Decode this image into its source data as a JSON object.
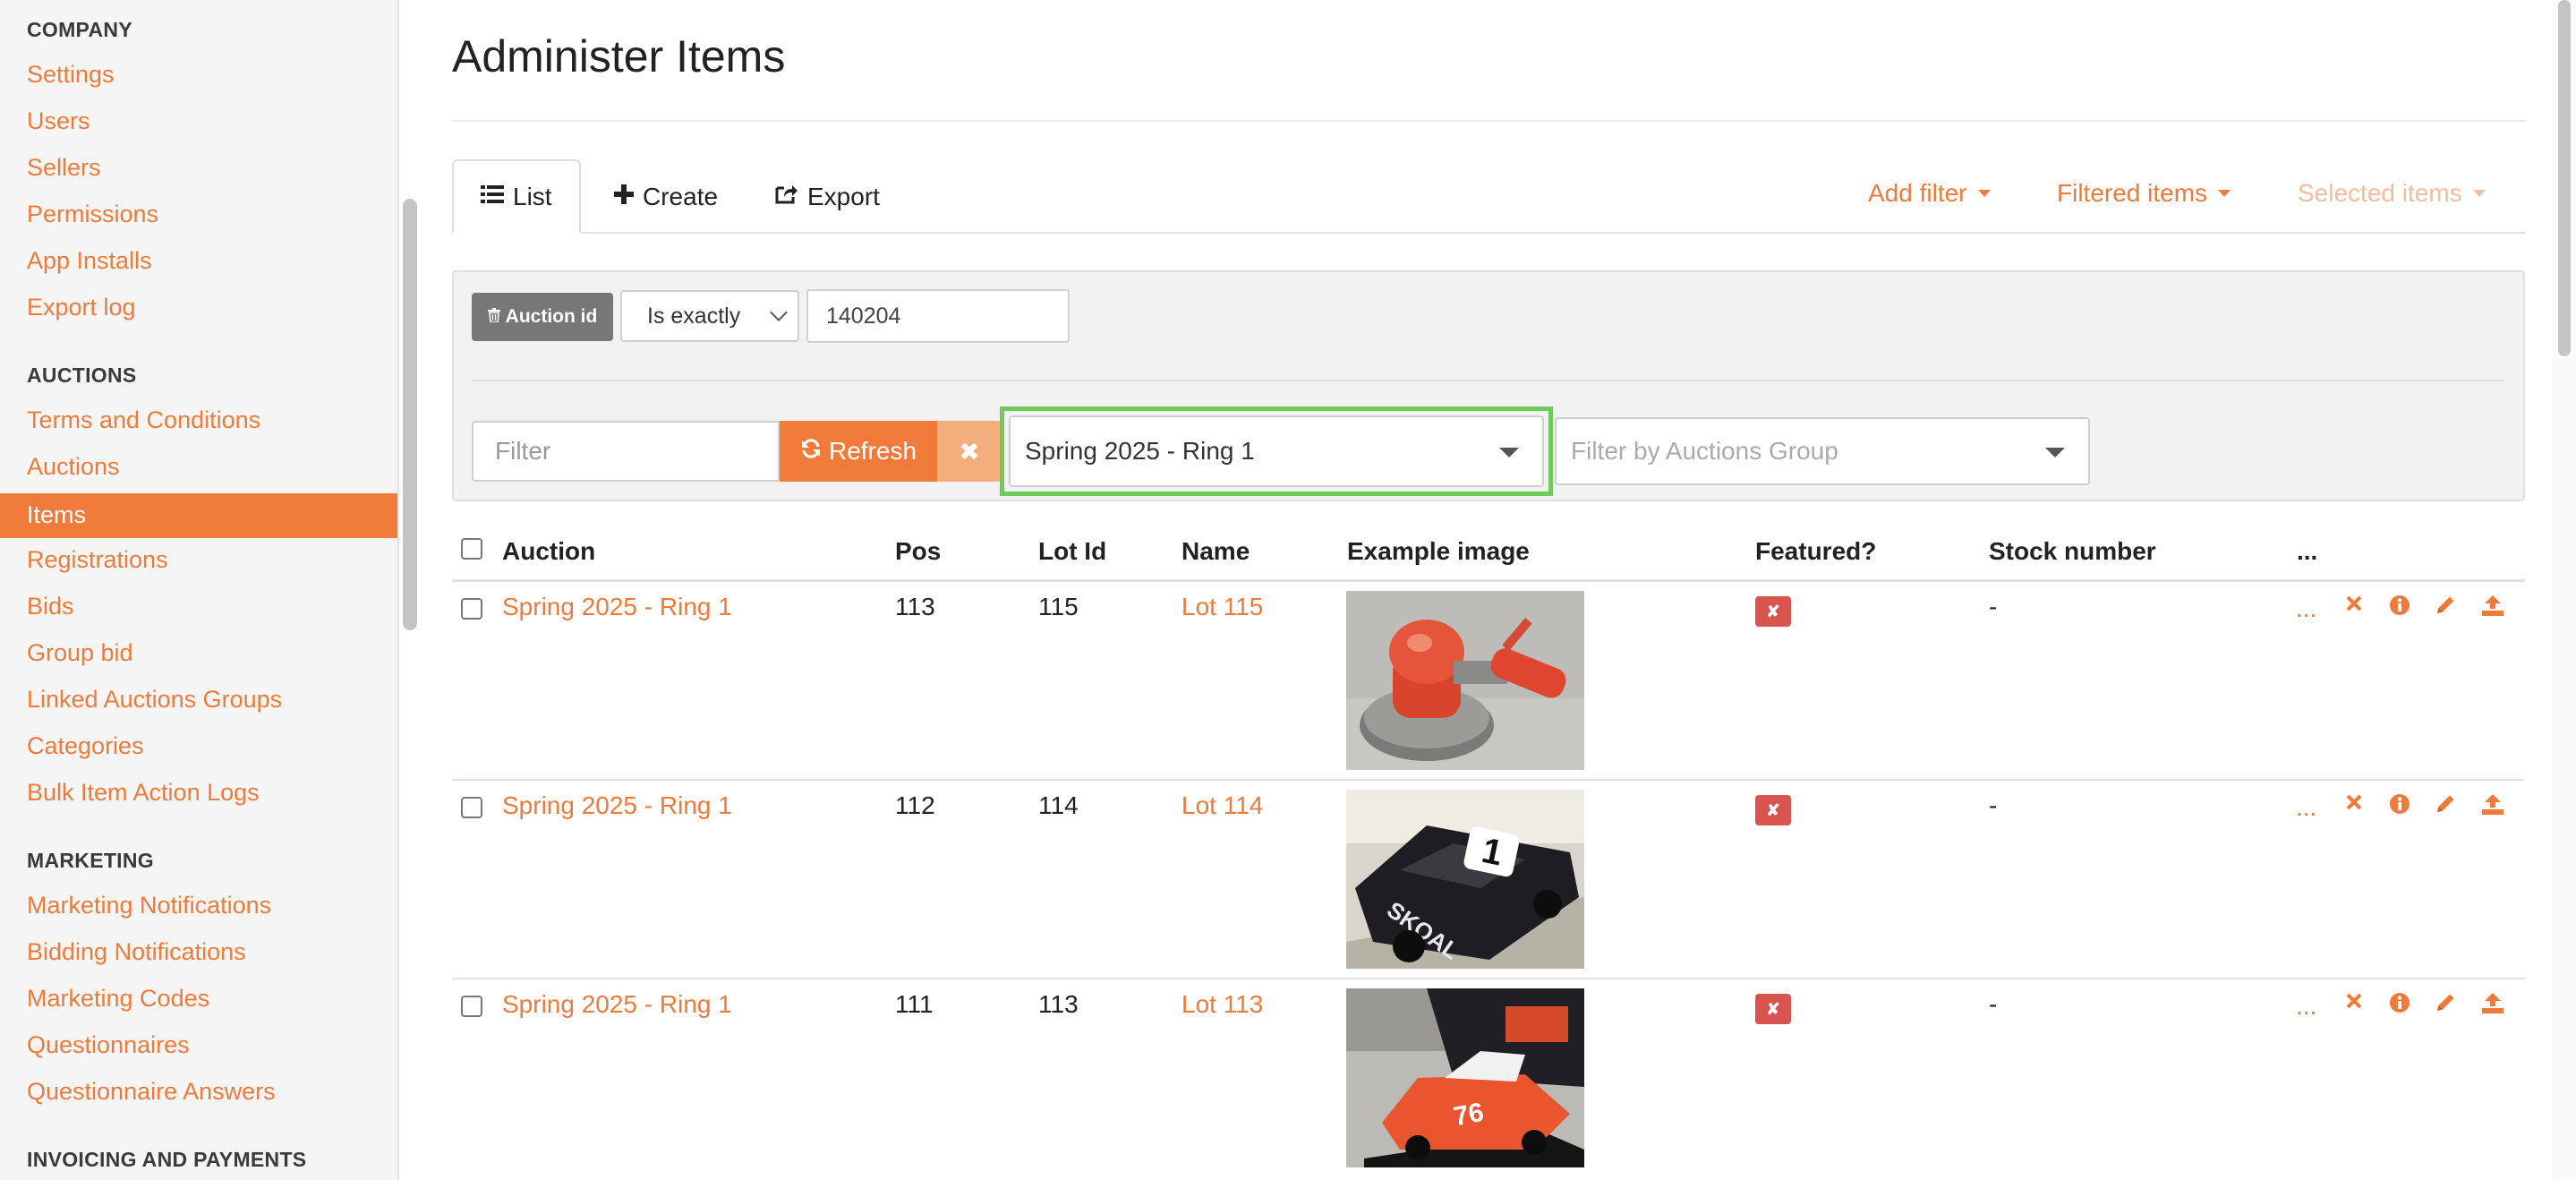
{
  "sidebar": {
    "company_heading": "COMPANY",
    "company_items": [
      "Settings",
      "Users",
      "Sellers",
      "Permissions",
      "App Installs",
      "Export log"
    ],
    "auctions_heading": "AUCTIONS",
    "auctions_items": [
      "Terms and Conditions",
      "Auctions",
      "Items",
      "Registrations",
      "Bids",
      "Group bid",
      "Linked Auctions Groups",
      "Categories",
      "Bulk Item Action Logs"
    ],
    "active_item": "Items",
    "marketing_heading": "MARKETING",
    "marketing_items": [
      "Marketing Notifications",
      "Bidding Notifications",
      "Marketing Codes",
      "Questionnaires",
      "Questionnaire Answers"
    ],
    "invoicing_heading": "INVOICING AND PAYMENTS"
  },
  "page": {
    "title": "Administer Items"
  },
  "tabs": {
    "list": "List",
    "create": "Create",
    "export": "Export",
    "add_filter": "Add filter",
    "filtered_items": "Filtered items",
    "selected_items": "Selected items"
  },
  "filters": {
    "chip_label": "Auction id",
    "operator": "Is exactly",
    "value": "140204",
    "search_placeholder": "Filter",
    "refresh_label": "Refresh",
    "clear_label": "✖",
    "auction_selected": "Spring 2025 - Ring 1",
    "group_placeholder": "Filter by Auctions Group"
  },
  "table": {
    "headers": {
      "auction": "Auction",
      "pos": "Pos",
      "lot_id": "Lot Id",
      "name": "Name",
      "example_image": "Example image",
      "featured": "Featured?",
      "stock_number": "Stock number",
      "more": "..."
    },
    "rows": [
      {
        "auction": "Spring 2025 - Ring 1",
        "pos": "113",
        "lot_id": "115",
        "name": "Lot 115",
        "featured": "✘",
        "stock_number": "-",
        "more": "..."
      },
      {
        "auction": "Spring 2025 - Ring 1",
        "pos": "112",
        "lot_id": "114",
        "name": "Lot 114",
        "featured": "✘",
        "stock_number": "-",
        "more": "..."
      },
      {
        "auction": "Spring 2025 - Ring 1",
        "pos": "111",
        "lot_id": "113",
        "name": "Lot 113",
        "featured": "✘",
        "stock_number": "-",
        "more": "..."
      }
    ]
  },
  "colors": {
    "accent": "#ef7a3a",
    "accent_light": "#f4ad7c",
    "danger": "#d9534f",
    "highlight": "#6fcb5d"
  },
  "icons": [
    "list-icon",
    "plus-icon",
    "export-icon",
    "trash-icon",
    "refresh-icon",
    "close-icon",
    "info-icon",
    "pencil-icon",
    "upload-icon",
    "caret-down-icon"
  ]
}
